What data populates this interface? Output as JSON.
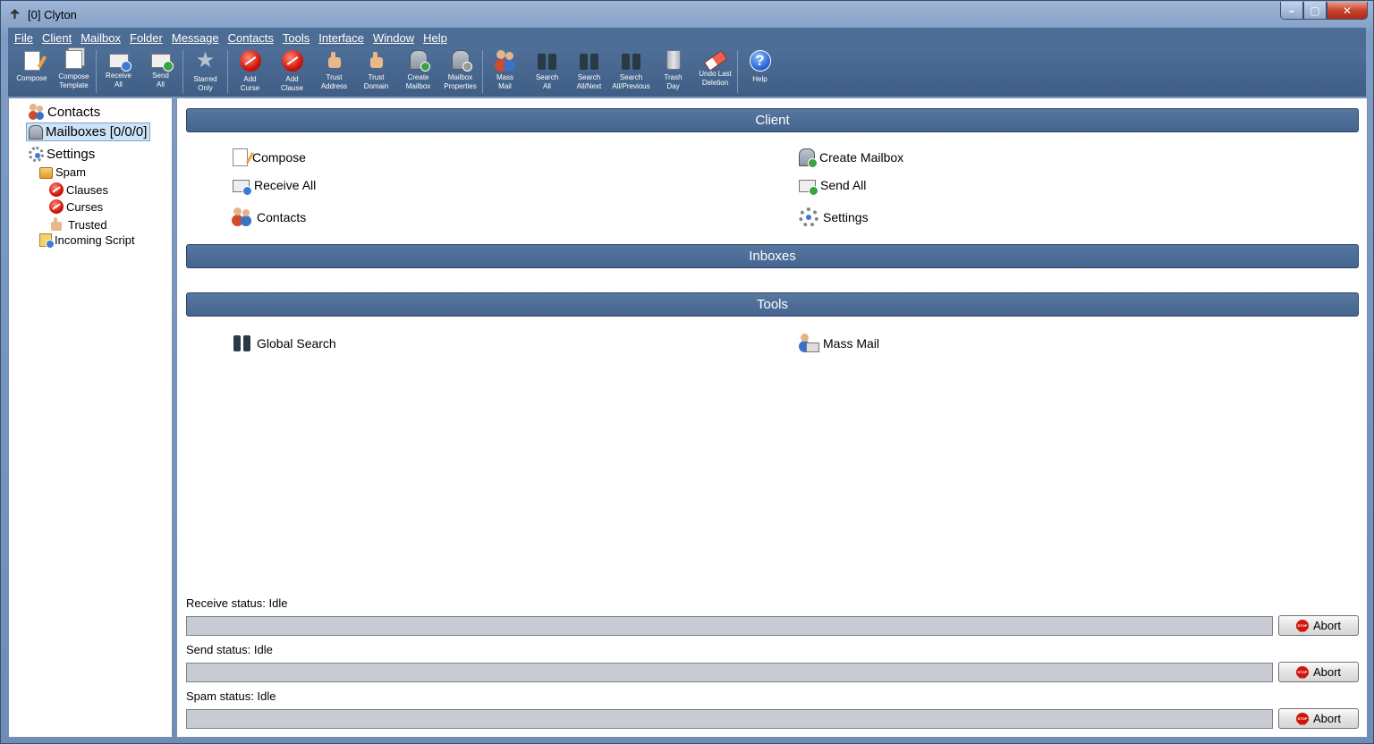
{
  "window": {
    "title": "[0] Clyton"
  },
  "menu": [
    "File",
    "Client",
    "Mailbox",
    "Folder",
    "Message",
    "Contacts",
    "Tools",
    "Interface",
    "Window",
    "Help"
  ],
  "toolbar": [
    {
      "id": "compose",
      "l1": "Compose",
      "l2": "",
      "icon": "compose-icon"
    },
    {
      "id": "compose-template",
      "l1": "Compose",
      "l2": "Template",
      "icon": "compose-template-icon"
    },
    {
      "id": "receive-all",
      "l1": "Receive",
      "l2": "All",
      "icon": "receive-mail-icon"
    },
    {
      "id": "send-all",
      "l1": "Send",
      "l2": "All",
      "icon": "send-mail-icon"
    },
    {
      "id": "starred-only",
      "l1": "Starred",
      "l2": "Only",
      "icon": "star-icon"
    },
    {
      "id": "add-curse",
      "l1": "Add",
      "l2": "Curse",
      "icon": "curse-icon"
    },
    {
      "id": "add-clause",
      "l1": "Add",
      "l2": "Clause",
      "icon": "clause-icon"
    },
    {
      "id": "trust-address",
      "l1": "Trust",
      "l2": "Address",
      "icon": "thumbs-up-icon"
    },
    {
      "id": "trust-domain",
      "l1": "Trust",
      "l2": "Domain",
      "icon": "thumbs-up-globe-icon"
    },
    {
      "id": "create-mailbox",
      "l1": "Create",
      "l2": "Mailbox",
      "icon": "mailbox-add-icon"
    },
    {
      "id": "mailbox-properties",
      "l1": "Mailbox",
      "l2": "Properties",
      "icon": "mailbox-gear-icon"
    },
    {
      "id": "mass-mail",
      "l1": "Mass",
      "l2": "Mail",
      "icon": "mass-mail-icon"
    },
    {
      "id": "search-all",
      "l1": "Search",
      "l2": "All",
      "icon": "binoculars-icon"
    },
    {
      "id": "search-all-next",
      "l1": "Search",
      "l2": "All/Next",
      "icon": "binoculars-next-icon"
    },
    {
      "id": "search-all-previous",
      "l1": "Search",
      "l2": "All/Previous",
      "icon": "binoculars-previous-icon"
    },
    {
      "id": "trash-day",
      "l1": "Trash",
      "l2": "Day",
      "icon": "trash-icon"
    },
    {
      "id": "undo-last-deletion",
      "l1": "Undo Last",
      "l2": "Deletion",
      "icon": "eraser-icon"
    },
    {
      "id": "help",
      "l1": "Help",
      "l2": "",
      "icon": "help-icon"
    }
  ],
  "sidebar": {
    "contacts": "Contacts",
    "mailboxes": "Mailboxes [0/0/0]",
    "settings": "Settings",
    "spam": "Spam",
    "clauses": "Clauses",
    "curses": "Curses",
    "trusted": "Trusted",
    "incoming_script": "Incoming Script"
  },
  "sections": {
    "client": "Client",
    "inboxes": "Inboxes",
    "tools": "Tools"
  },
  "client_links": {
    "compose": "Compose",
    "receive_all": "Receive All",
    "contacts": "Contacts",
    "create_mailbox": "Create Mailbox",
    "send_all": "Send All",
    "settings": "Settings"
  },
  "tools_links": {
    "global_search": "Global Search",
    "mass_mail": "Mass Mail"
  },
  "status": {
    "receive": {
      "label": "Receive status: Idle",
      "progress": 0
    },
    "send": {
      "label": "Send status: Idle",
      "progress": 0
    },
    "spam": {
      "label": "Spam status: Idle",
      "progress": 0
    },
    "abort_label": "Abort",
    "stop_text": "STOP"
  }
}
